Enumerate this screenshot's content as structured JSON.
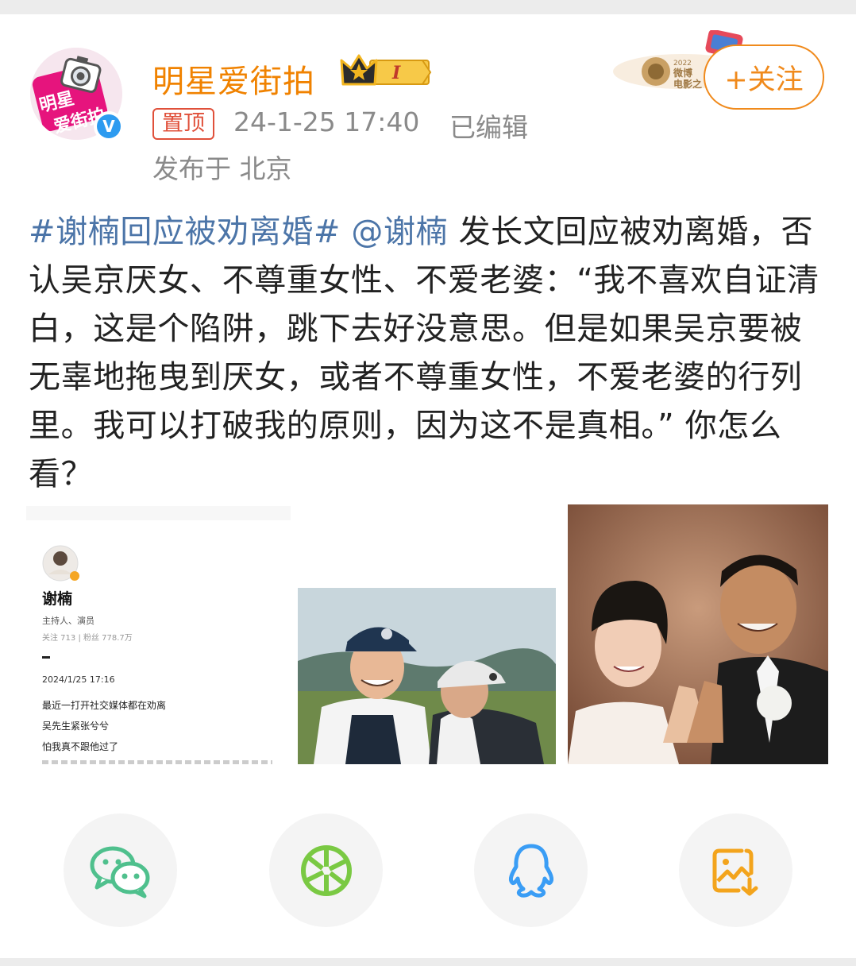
{
  "author": {
    "name": "明星爱街拍",
    "avatar_text": "明星爱街拍",
    "level_badge": "I",
    "verified_mark": "V"
  },
  "meta": {
    "pinned_label": "置顶",
    "time": "24-1-25 17:40",
    "edited_label": "已编辑",
    "location": "发布于 北京"
  },
  "follow_label": "+关注",
  "post": {
    "hashtag": "#谢楠回应被劝离婚#",
    "mention": "@谢楠",
    "text": " 发长文回应被劝离婚，否认吴京厌女、不尊重女性、不爱老婆：“我不喜欢自证清白，这是个陷阱，跳下去好没意思。但是如果吴京要被无辜地拖曳到厌女，或者不尊重女性，不爱老婆的行列里。我可以打破我的原则，因为这不是真相。” 你怎么看？"
  },
  "image1": {
    "profile_name": "谢楠",
    "profile_role": "主持人、演员",
    "profile_stats": "关注 713 | 粉丝 778.7万",
    "date": "2024/1/25 17:16",
    "lines": [
      "最近一打开社交媒体都在劝离",
      "吴先生紧张兮兮",
      "怕我真不跟他过了"
    ]
  },
  "share": [
    {
      "name": "wechat-icon",
      "color": "#4fc08d"
    },
    {
      "name": "moments-icon",
      "color": "#7ac943"
    },
    {
      "name": "qq-icon",
      "color": "#3a9df5"
    },
    {
      "name": "save-image-icon",
      "color": "#f3a41c"
    }
  ]
}
